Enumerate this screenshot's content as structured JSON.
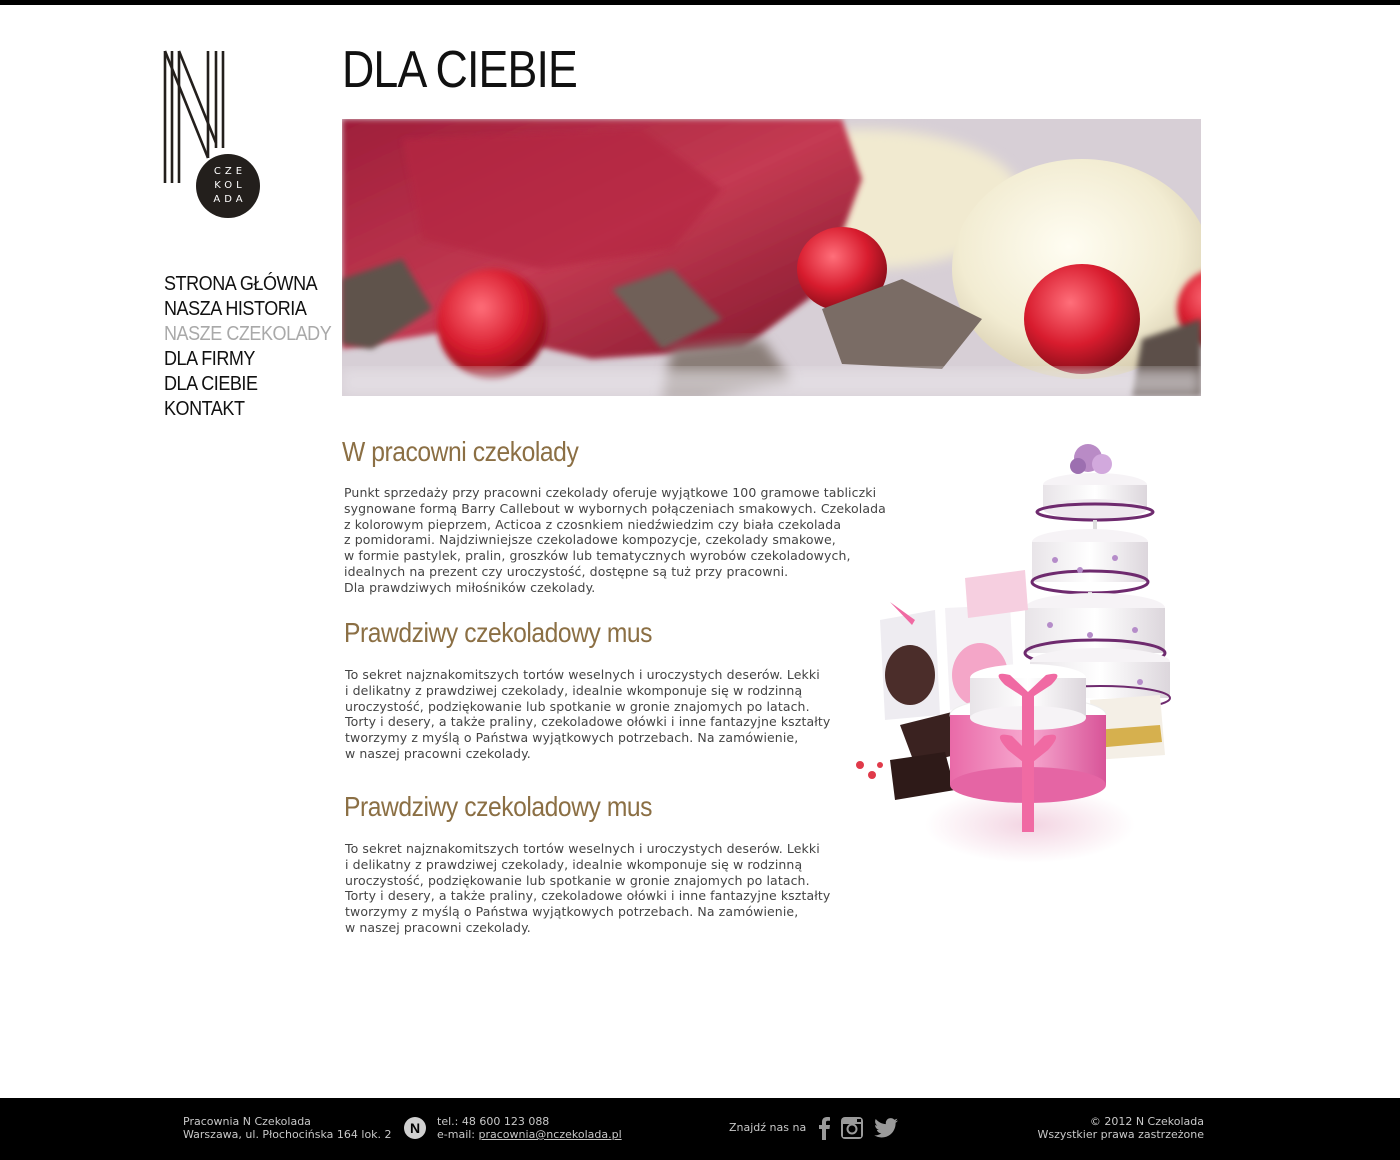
{
  "logo": {
    "circle_lines": [
      "CZE",
      "KOL",
      "ADA"
    ]
  },
  "nav": {
    "items": [
      {
        "label": "STRONA GŁÓWNA",
        "active": false
      },
      {
        "label": "NASZA HISTORIA",
        "active": false
      },
      {
        "label": "NASZE CZEKOLADY",
        "active": true
      },
      {
        "label": "DLA FIRMY",
        "active": false
      },
      {
        "label": "DLA CIEBIE",
        "active": false
      },
      {
        "label": "KONTAKT",
        "active": false
      }
    ]
  },
  "page": {
    "title": "DLA CIEBIE"
  },
  "sections": [
    {
      "title": "W pracowni czekolady",
      "text": "Punkt sprzedaży przy pracowni czekolady oferuje wyjątkowe 100 gramowe tabliczki\nsygnowane formą Barry Callebout w wybornych połączeniach smakowych. Czekolada\nz kolorowym pieprzem, Acticoa z czosnkiem niedźwiedzim czy biała czekolada\nz pomidorami. Najdziwniejsze czekoladowe kompozycje, czekolady smakowe,\nw formie pastylek, pralin, groszków lub tematycznych wyrobów czekoladowych,\nidealnych na prezent czy uroczystość, dostępne są tuż przy pracowni.\nDla prawdziwych miłośników czekolady."
    },
    {
      "title": "Prawdziwy czekoladowy mus",
      "text": "To sekret najznakomitszych tortów weselnych i uroczystych deserów. Lekki\ni delikatny z prawdziwej czekolady, idealnie wkomponuje się w rodzinną\nuroczystość, podziękowanie lub spotkanie w gronie znajomych po latach.\nTorty i desery, a także praliny, czekoladowe ołówki i inne fantazyjne kształty\ntworzymy z myślą o Państwa wyjątkowych potrzebach. Na zamówienie,\nw naszej pracowni czekolady."
    },
    {
      "title": "Prawdziwy czekoladowy mus",
      "text": "To sekret najznakomitszych tortów weselnych i uroczystych deserów. Lekki\ni delikatny z prawdziwej czekolady, idealnie wkomponuje się w rodzinną\nuroczystość, podziękowanie lub spotkanie w gronie znajomych po latach.\nTorty i desery, a także praliny, czekoladowe ołówki i inne fantazyjne kształty\ntworzymy z myślą o Państwa wyjątkowych potrzebach. Na zamówienie,\nw naszej pracowni czekolady."
    }
  ],
  "footer": {
    "company": "Pracownia N Czekolada",
    "address": "Warszawa, ul. Płochocińska  164 lok. 2",
    "badge": "N",
    "phone": "tel.: 48 600 123 088",
    "email_label": "e-mail: ",
    "email": "pracownia@nczekolada.pl",
    "find_us": "Znajdź nas na",
    "social_icons": [
      "facebook-icon",
      "instagram-icon",
      "twitter-icon"
    ],
    "copyright": "© 2012 N Czekolada",
    "rights": "Wszystkier prawa zastrzeżone"
  },
  "colors": {
    "accent": "#8b6f44",
    "nav_active": "#a9a9a9",
    "footer_bg": "#000000"
  }
}
